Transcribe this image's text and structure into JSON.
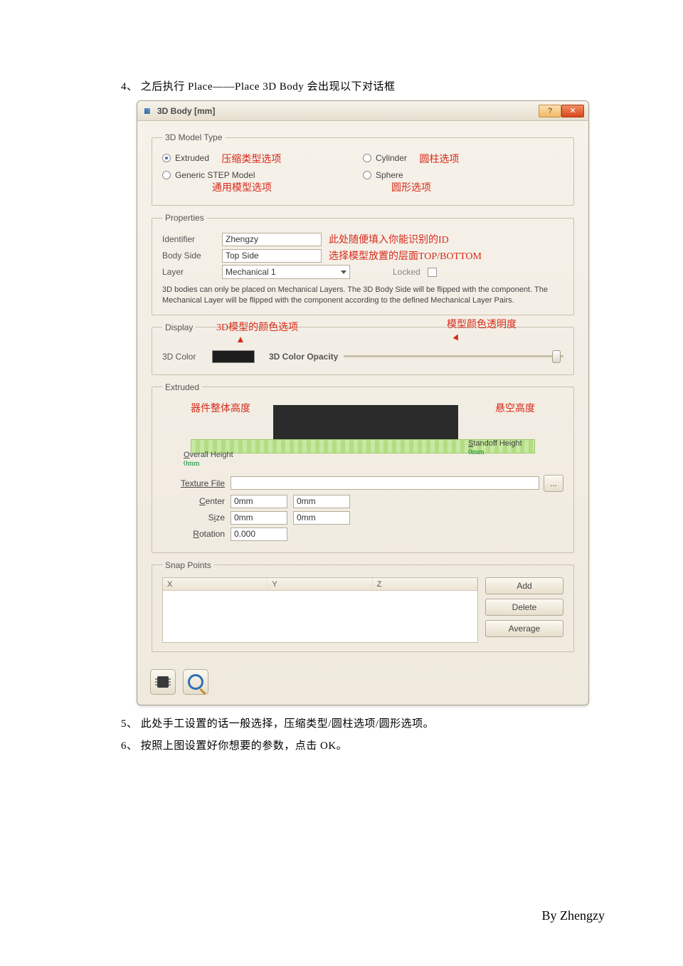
{
  "doc": {
    "step4": "4、 之后执行 Place——Place 3D Body 会出现以下对话框",
    "step5": "5、 此处手工设置的话一般选择，压缩类型/圆柱选项/圆形选项。",
    "step6": "6、 按照上图设置好你想要的参数，点击 OK。",
    "by": "By Zhengzy"
  },
  "dialog": {
    "title": "3D Body [mm]",
    "help_btn": "?",
    "close_btn": "✕",
    "model_type": {
      "legend": "3D Model Type",
      "extruded": "Extruded",
      "extruded_note": "压缩类型选项",
      "cylinder": "Cylinder",
      "cylinder_note": "圆柱选项",
      "generic": "Generic STEP Model",
      "generic_note": "通用模型选项",
      "sphere": "Sphere",
      "sphere_note": "圆形选项"
    },
    "properties": {
      "legend": "Properties",
      "identifier_lbl": "Identifier",
      "identifier_val": "Zhengzy",
      "identifier_note": "此处随便填入你能识别的ID",
      "bodyside_lbl": "Body Side",
      "bodyside_val": "Top Side",
      "bodyside_note": "选择模型放置的层面TOP/BOTTOM",
      "layer_lbl": "Layer",
      "layer_val": "Mechanical 1",
      "locked_lbl": "Locked",
      "info": "3D bodies can only be placed on Mechanical Layers. The 3D Body Side will be flipped with the component. The Mechanical Layer will be flipped with the component according to the defined Mechanical Layer Pairs."
    },
    "display": {
      "legend": "Display",
      "note_left": "3D模型的颜色选项",
      "note_right": "模型颜色透明度",
      "color_lbl": "3D Color",
      "opacity_lbl": "3D Color Opacity"
    },
    "extruded": {
      "legend": "Extruded",
      "note_left": "器件整体高度",
      "note_right": "悬空高度",
      "overall_lbl": "Overall Height",
      "overall_val": "0mm",
      "standoff_lbl": "Standoff Height",
      "standoff_val": "0mm",
      "tfile_lbl": "Texture File",
      "browse": "...",
      "center_lbl": "Center",
      "center_x": "0mm",
      "center_y": "0mm",
      "size_lbl": "Size",
      "size_x": "0mm",
      "size_y": "0mm",
      "rotation_lbl": "Rotation",
      "rotation_val": "0.000"
    },
    "snap": {
      "legend": "Snap Points",
      "x": "X",
      "y": "Y",
      "z": "Z",
      "add": "Add",
      "delete": "Delete",
      "average": "Average"
    }
  }
}
